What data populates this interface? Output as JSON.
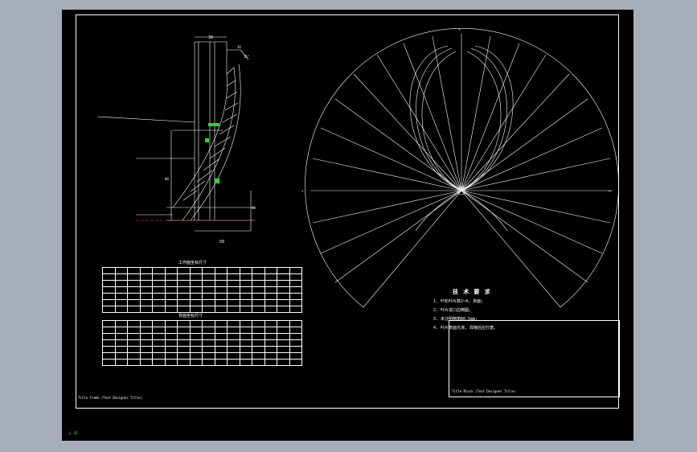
{
  "drawing": {
    "table1_title": "工作面坐标尺寸",
    "table2_title": "背面坐标尺寸",
    "notes_title": "技 术 要 求",
    "notes": [
      "1. 叶轮叶片数2~4, 单面;",
      "2. 叶片进口边倒圆;",
      "3. 未注明倒角R0.5mm;",
      "4. 叶片表面光滑, 焊接后应打磨。"
    ],
    "title_block_text": "Title Block (Text Designer Title)",
    "frame_label": "Title Frame (Text Designer Title)",
    "ucs_label": "⊥ ⊞",
    "dimensions": {
      "top_width": "38",
      "top_offset": "16",
      "angle": "15°",
      "height": "80",
      "bottom_width": "50",
      "lower_height": "40"
    }
  },
  "colors": {
    "background": "#000000",
    "outer": "#a7aeb9",
    "lines": "#ffffff",
    "accent": "#22dd22",
    "centerline": "#ff3333"
  }
}
